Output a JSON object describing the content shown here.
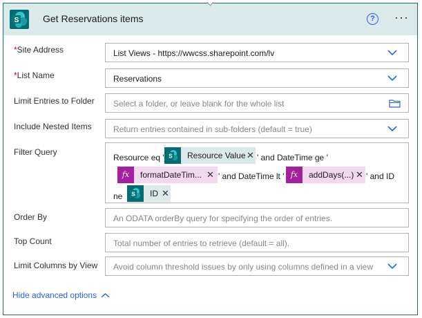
{
  "header": {
    "title": "Get Reservations items",
    "help_icon": "help-circle-icon",
    "more_icon": "more-horizontal-icon",
    "logo_letter": "S"
  },
  "fields": {
    "site_address": {
      "label": "Site Address",
      "required": true,
      "value": "List Views - https://wwcss.sharepoint.com/lv"
    },
    "list_name": {
      "label": "List Name",
      "required": true,
      "value": "Reservations"
    },
    "limit_folder": {
      "label": "Limit Entries to Folder",
      "placeholder": "Select a folder, or leave blank for the whole list"
    },
    "nested_items": {
      "label": "Include Nested Items",
      "placeholder": "Return entries contained in sub-folders (default = true)"
    },
    "filter_query": {
      "label": "Filter Query",
      "text1": "Resource eq '",
      "token1": "Resource Value",
      "text2": "' and DateTime ge '",
      "token2": "formatDateTim...",
      "text3": "' and DateTime lt '",
      "token3": "addDays(...)",
      "text4": "' and ID",
      "text5": "ne",
      "token4": "ID",
      "fx": "fx"
    },
    "order_by": {
      "label": "Order By",
      "placeholder": "An ODATA orderBy query for specifying the order of entries."
    },
    "top_count": {
      "label": "Top Count",
      "placeholder": "Total number of entries to retrieve (default = all)."
    },
    "limit_columns": {
      "label": "Limit Columns by View",
      "placeholder": "Avoid column threshold issues by only using columns defined in a view"
    }
  },
  "footer": {
    "hide_advanced": "Hide advanced options"
  },
  "required_marker": "*",
  "remove_glyph": "✕",
  "colors": {
    "accent": "#036c70",
    "header_bg": "#dce9ea",
    "link": "#2563eb",
    "required": "#c50f1f",
    "fx": "#a4209e"
  }
}
